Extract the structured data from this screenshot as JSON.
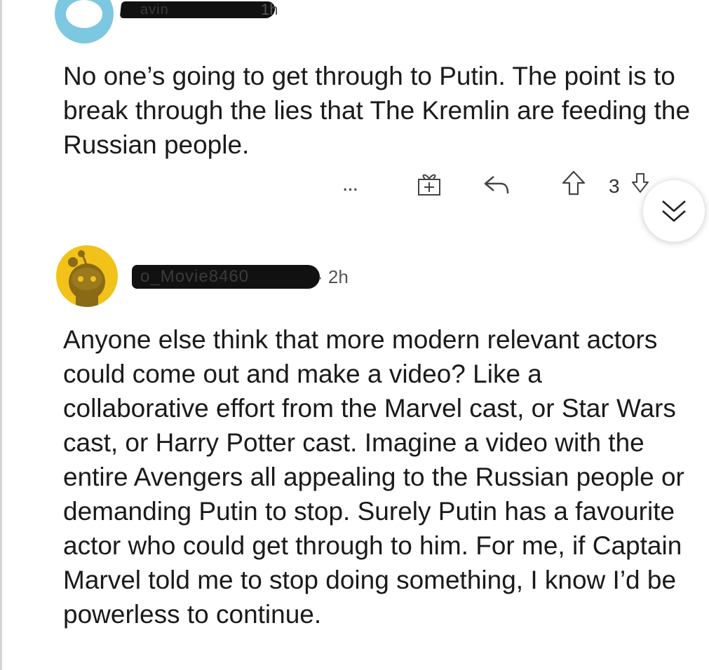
{
  "comments": [
    {
      "username_visible_fragment": "avin",
      "time": "1h",
      "body": "No one’s going to get through to Putin. The point is to break through the lies that The Kremlin are feeding the Russian people.",
      "actions": {
        "more": "...",
        "vote_count": "3"
      },
      "icons": [
        "more-icon",
        "gift-icon",
        "reply-icon",
        "upvote-icon",
        "downvote-icon",
        "collapse-chevron-icon"
      ]
    },
    {
      "username_visible_fragment": "o_Movie8460",
      "time": "· 2h",
      "body": "Anyone else think that more modern relevant actors could come out and make a video? Like a collaborative effort from the Marvel cast, or Star Wars cast, or Harry Potter cast. Imagine a video with the entire Avengers all appealing to the Russian people or demanding Putin to stop. Surely Putin has a favourite actor who could get through to him. For me, if Captain Marvel told me to stop doing something, I know I’d be powerless to continue."
    }
  ],
  "colors": {
    "avatar1": "#7cc8e0",
    "avatar2": "#f2c21a",
    "redaction": "#111111",
    "text": "#1a1a1a"
  }
}
